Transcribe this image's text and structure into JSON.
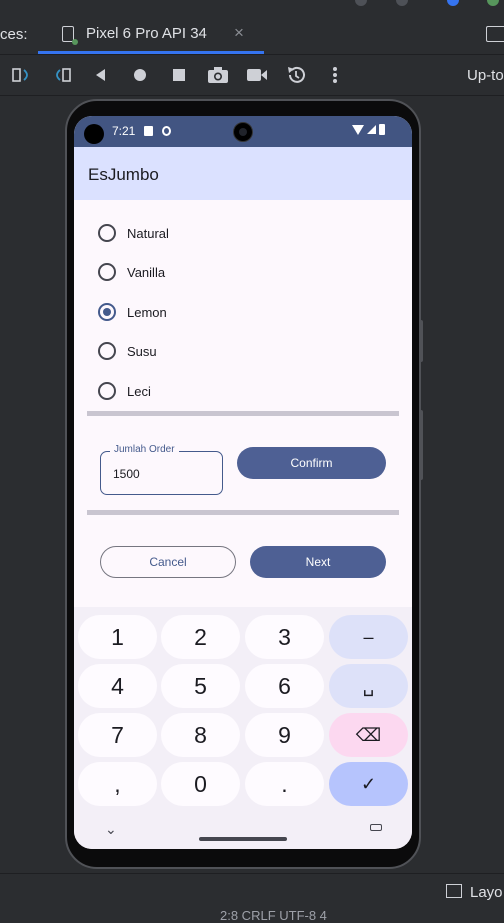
{
  "ide": {
    "tab_prefix": "ces:",
    "device_tab": "Pixel 6 Pro API 34",
    "tab_close": "×",
    "toolbar_right": "Up-to",
    "bottom_label": "Layo",
    "bottom_status": "2:8   CRLF   UTF-8   4"
  },
  "toolbar": {
    "icons": [
      "rotate-left-icon",
      "rotate-right-icon",
      "back-icon",
      "home-icon",
      "overview-icon",
      "camera-icon",
      "screenrecord-icon",
      "snapshot-icon",
      "more-icon"
    ]
  },
  "status": {
    "time": "7:21"
  },
  "app": {
    "title": "EsJumbo",
    "flavors": [
      "Natural",
      "Vanilla",
      "Lemon",
      "Susu",
      "Leci"
    ],
    "selected_flavor": "Lemon",
    "quantity_label": "Jumlah Order",
    "quantity_value": "1500",
    "confirm_label": "Confirm",
    "cancel_label": "Cancel",
    "next_label": "Next"
  },
  "keyboard": {
    "row1": [
      "1",
      "2",
      "3",
      "–"
    ],
    "row2": [
      "4",
      "5",
      "6",
      "␣"
    ],
    "row3": [
      "7",
      "8",
      "9",
      "⌫"
    ],
    "row4": [
      ",",
      "0",
      ".",
      "✓"
    ],
    "nav_down": "⌄"
  },
  "colors": {
    "status_bar": "#425582",
    "app_bar": "#dbe1ff",
    "primary": "#4e6094",
    "ide_bg": "#2b2d30",
    "ide_accent": "#3574f0"
  }
}
